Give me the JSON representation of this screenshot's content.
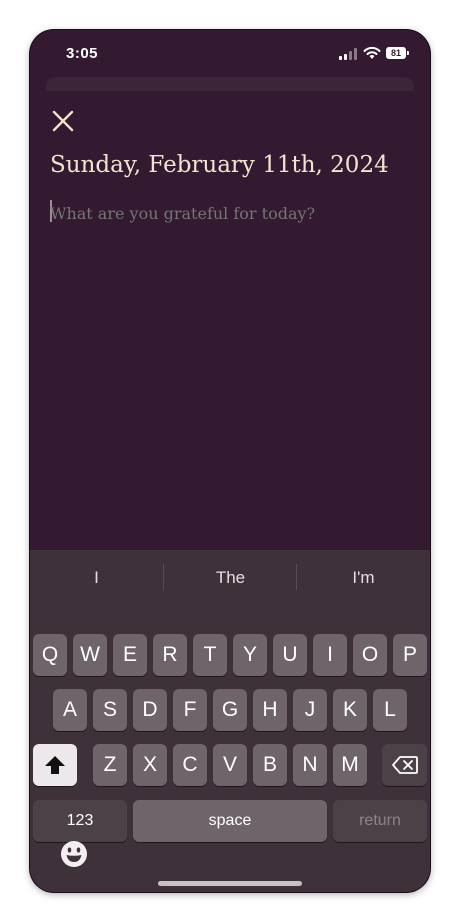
{
  "status": {
    "time": "3:05",
    "battery": "81"
  },
  "entry": {
    "date_title": "Sunday, February 11th, 2024",
    "placeholder": "What are you grateful for today?",
    "value": ""
  },
  "keyboard": {
    "suggestions": [
      "I",
      "The",
      "I'm"
    ],
    "row1": [
      "Q",
      "W",
      "E",
      "R",
      "T",
      "Y",
      "U",
      "I",
      "O",
      "P"
    ],
    "row2": [
      "A",
      "S",
      "D",
      "F",
      "G",
      "H",
      "J",
      "K",
      "L"
    ],
    "row3": [
      "Z",
      "X",
      "C",
      "V",
      "B",
      "N",
      "M"
    ],
    "numbers_label": "123",
    "space_label": "space",
    "return_label": "return"
  },
  "icons": [
    "close-icon",
    "shift-icon",
    "backspace-icon",
    "emoji-icon",
    "wifi-icon",
    "signal-icon",
    "battery-icon"
  ],
  "colors": {
    "background": "#331a30",
    "title": "#f3e4cf",
    "placeholder": "#8c7a87",
    "keyboard": "#3e313a"
  }
}
